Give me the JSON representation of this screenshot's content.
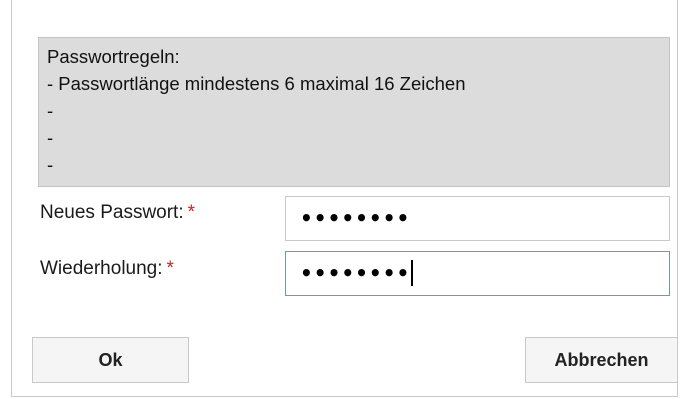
{
  "rules": {
    "heading": "Passwortregeln:",
    "lines": [
      "- Passwortlänge mindestens 6 maximal 16 Zeichen",
      "-",
      "-",
      "-"
    ]
  },
  "form": {
    "new_password": {
      "label": "Neues Passwort:",
      "required_mark": "*",
      "value": "••••••••"
    },
    "repeat": {
      "label": "Wiederholung:",
      "required_mark": "*",
      "value": "••••••••"
    }
  },
  "buttons": {
    "ok_label": "Ok",
    "cancel_label": "Abbrechen"
  },
  "colors": {
    "required": "#d21f1f",
    "rules_background": "#dcdcdc",
    "focus_border": "#6d95c7"
  }
}
